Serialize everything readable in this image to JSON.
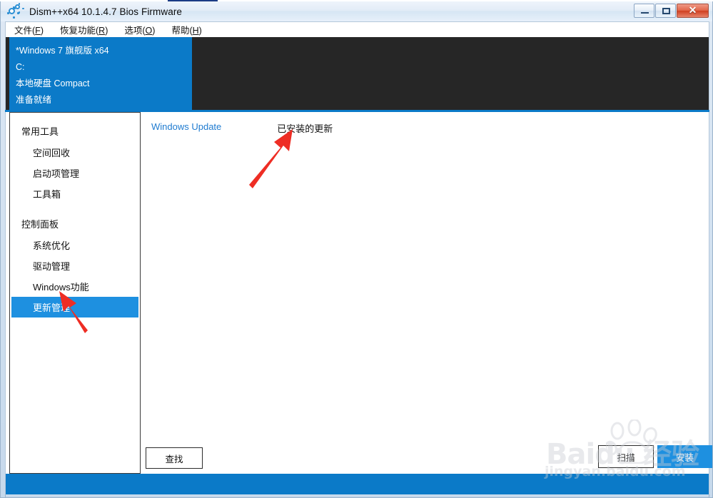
{
  "window": {
    "title": "Dism++x64 10.1.4.7 Bios Firmware",
    "icon": "gears-icon",
    "controls": {
      "minimize": "minimize-button",
      "maximize": "maximize-button",
      "close_glyph": "✕"
    }
  },
  "menubar": {
    "items": [
      {
        "label": "文件(F)",
        "text": "文件(",
        "mnemonic": "F",
        "tail": ")"
      },
      {
        "label": "恢复功能(R)",
        "text": "恢复功能(",
        "mnemonic": "R",
        "tail": ")"
      },
      {
        "label": "选项(O)",
        "text": "选项(",
        "mnemonic": "O",
        "tail": ")"
      },
      {
        "label": "帮助(H)",
        "text": "帮助(",
        "mnemonic": "H",
        "tail": ")"
      }
    ]
  },
  "info_panel": {
    "os": "*Windows 7 旗舰版 x64",
    "drive": "C:",
    "disk": "本地硬盘 Compact",
    "status": "准备就绪"
  },
  "sidebar": {
    "groups": [
      {
        "title": "常用工具",
        "items": [
          {
            "label": "空间回收",
            "selected": false
          },
          {
            "label": "启动项管理",
            "selected": false
          },
          {
            "label": "工具箱",
            "selected": false
          }
        ]
      },
      {
        "title": "控制面板",
        "items": [
          {
            "label": "系统优化",
            "selected": false
          },
          {
            "label": "驱动管理",
            "selected": false
          },
          {
            "label": "Windows功能",
            "selected": false
          },
          {
            "label": "更新管理",
            "selected": true
          }
        ]
      }
    ]
  },
  "content": {
    "tabs": [
      {
        "label": "Windows Update",
        "active": false
      },
      {
        "label": "已安装的更新",
        "active": true
      }
    ],
    "buttons": {
      "find": "查找",
      "scan": "扫描",
      "install": "安装"
    }
  },
  "watermark": {
    "brand": "Baidu 经验",
    "url": "jingyan.baidu.com"
  },
  "colors": {
    "accent_blue": "#0b7ac8",
    "select_blue": "#1e90e0",
    "link_blue": "#1f7bd0",
    "dark_panel": "#262626",
    "arrow_red": "#ee2d24"
  }
}
